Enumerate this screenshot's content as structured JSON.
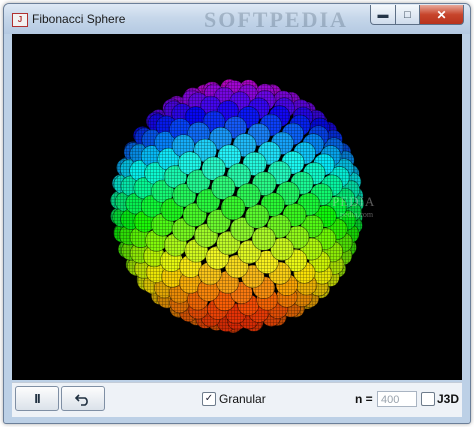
{
  "window": {
    "title": "Fibonacci Sphere",
    "watermark": "SOFTPEDIA"
  },
  "canvas": {
    "watermark_main": "PEDIA",
    "watermark_sub": "pedia.com"
  },
  "controls": {
    "minimize_icon": "minimize-icon",
    "maximize_icon": "maximize-icon",
    "close_icon": "close-icon"
  },
  "toolbar": {
    "pause_label": "II",
    "reset_icon": "undo-icon",
    "granular_label": "Granular",
    "granular_checked": true,
    "n_label": "n =",
    "n_value": "400",
    "j3d_label": "J3D",
    "j3d_checked": false
  }
}
